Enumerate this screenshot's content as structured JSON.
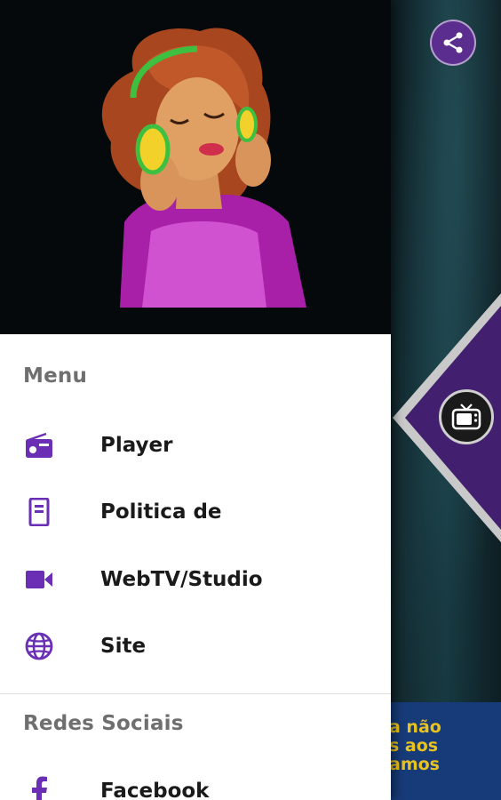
{
  "drawer": {
    "sections": [
      {
        "title": "Menu",
        "items": [
          {
            "label": "Player",
            "icon": "radio-icon"
          },
          {
            "label": "Politica de",
            "icon": "document-icon"
          },
          {
            "label": "WebTV/Studio",
            "icon": "videocam-icon"
          },
          {
            "label": "Site",
            "icon": "globe-icon"
          }
        ]
      },
      {
        "title": "Redes Sociais",
        "items": [
          {
            "label": "Facebook",
            "icon": "facebook-icon"
          }
        ]
      }
    ]
  },
  "background": {
    "banner_text": "a não\ns aos\namos"
  },
  "colors": {
    "accent": "#6a2fb4",
    "header_bg": "#05090b",
    "share_button": "#5b2d8e",
    "banner_bg": "#173a78",
    "banner_text": "#e8c21e"
  }
}
